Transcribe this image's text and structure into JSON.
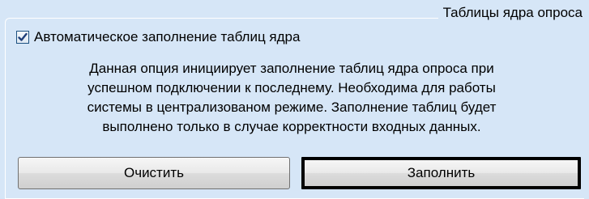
{
  "group": {
    "legend": "Таблицы ядра опроса"
  },
  "auto_fill": {
    "checked": true,
    "label": "Автоматическое заполнение таблиц ядра"
  },
  "description": [
    "Данная опция инициирует заполнение таблиц ядра опроса при",
    "успешном подключении к последнему. Необходима для работы",
    "системы в централизованом режиме. Заполнение таблиц будет",
    "выполнено только в случае корректности входных данных."
  ],
  "buttons": {
    "clear_label": "Очистить",
    "fill_label": "Заполнить"
  },
  "colors": {
    "background": "#d6e6f7",
    "check_mark": "#1f3f7a",
    "focus_border": "#000000"
  }
}
